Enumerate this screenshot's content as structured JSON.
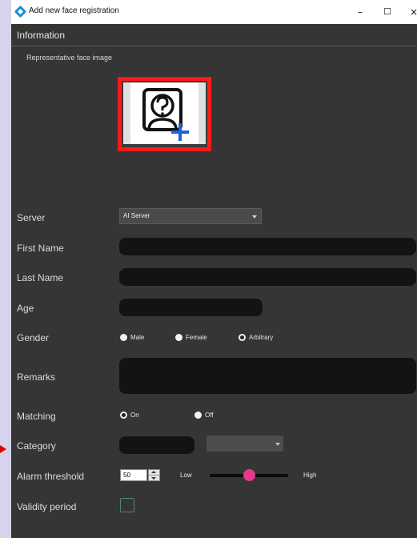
{
  "window": {
    "title": "Add new face registration",
    "controls": {
      "minimize": "–",
      "maximize": "☐",
      "close": "×"
    }
  },
  "section": {
    "header": "Information"
  },
  "face_image": {
    "label": "Representative face image",
    "icon": "add-face-icon"
  },
  "server": {
    "label": "Server",
    "value": "AI Server"
  },
  "first_name": {
    "label": "First Name",
    "value": ""
  },
  "last_name": {
    "label": "Last Name",
    "value": ""
  },
  "age": {
    "label": "Age",
    "value": ""
  },
  "gender": {
    "label": "Gender",
    "options": [
      "Male",
      "Female",
      "Arbitrary"
    ],
    "selected": "Arbitrary"
  },
  "remarks": {
    "label": "Remarks",
    "value": ""
  },
  "matching": {
    "label": "Matching",
    "on": "On",
    "off": "Off",
    "selected": "On"
  },
  "category": {
    "label": "Category",
    "value": "",
    "combo_value": ""
  },
  "alarm_threshold": {
    "label": "Alarm threshold",
    "value": "50",
    "low": "Low",
    "high": "High",
    "level_fraction": 0.5
  },
  "validity_period": {
    "label": "Validity period",
    "checked": false
  },
  "colors": {
    "accent_red": "#ff1a1a",
    "slider_thumb": "#e5398c",
    "window_bg": "#353535"
  }
}
